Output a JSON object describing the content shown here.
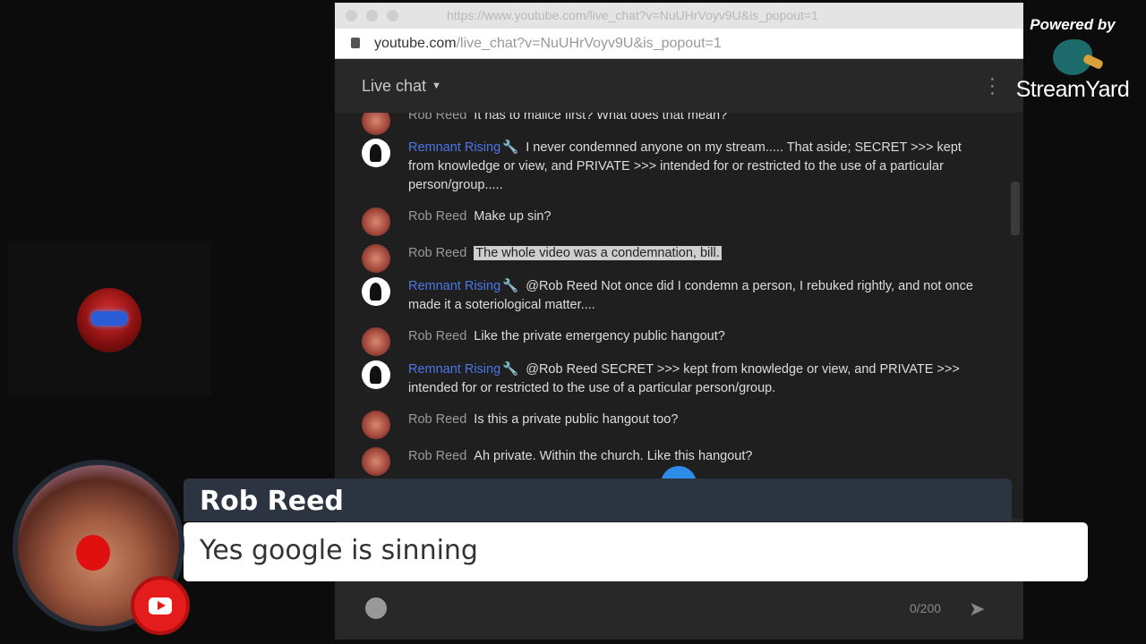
{
  "browser": {
    "title_url": "https://www.youtube.com/live_chat?v=NuUHrVoyv9U&is_popout=1",
    "address_domain": "youtube.com",
    "address_path": "/live_chat?v=NuUHrVoyv9U&is_popout=1"
  },
  "chat": {
    "title": "Live chat",
    "messages": [
      {
        "author": "Rob Reed",
        "text": "It has to malice first? What does that mean?"
      },
      {
        "author": "Remnant Rising",
        "text": "I never condemned anyone on my stream..... That aside; SECRET >>> kept from knowledge or view, and PRIVATE >>> intended for or restricted to the use of a particular person/group....."
      },
      {
        "author": "Rob Reed",
        "text": "Make up sin?"
      },
      {
        "author": "Rob Reed",
        "text": "The whole video was a condemnation, bill."
      },
      {
        "author": "Remnant Rising",
        "text": "@Rob Reed Not once did I condemn a person, I rebuked rightly, and not once made it a soteriological matter...."
      },
      {
        "author": "Rob Reed",
        "text": "Like the private emergency public hangout?"
      },
      {
        "author": "Remnant Rising",
        "text": "@Rob Reed SECRET >>> kept from knowledge or view, and PRIVATE >>> intended for or restricted to the use of a particular person/group."
      },
      {
        "author": "Rob Reed",
        "text": "Is this a private public hangout too?"
      },
      {
        "author": "Rob Reed",
        "text": "Ah private. Within the church. Like this hangout?"
      }
    ],
    "char_count": "0/200"
  },
  "branding": {
    "powered_by": "Powered by",
    "name": "StreamYard"
  },
  "overlay": {
    "author": "Rob Reed",
    "message": "Yes google is sinning"
  },
  "colors": {
    "moderator_name": "#4a76e8",
    "youtube_red": "#e51c1c",
    "banner_bg": "#2c3341"
  }
}
